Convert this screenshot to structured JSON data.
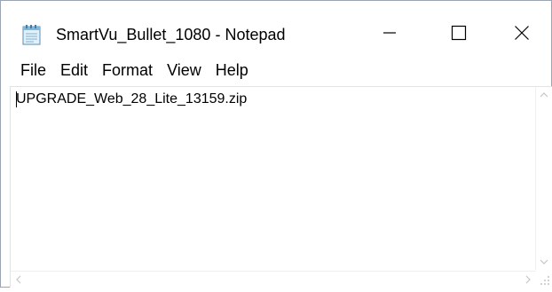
{
  "window": {
    "title": "SmartVu_Bullet_1080 - Notepad",
    "app_icon": "notepad-icon"
  },
  "controls": {
    "minimize_icon": "minimize-icon",
    "maximize_icon": "maximize-icon",
    "close_icon": "close-icon"
  },
  "menu": {
    "items": [
      {
        "label": "File"
      },
      {
        "label": "Edit"
      },
      {
        "label": "Format"
      },
      {
        "label": "View"
      },
      {
        "label": "Help"
      }
    ]
  },
  "editor": {
    "content": "UPGRADE_Web_28_Lite_13159.zip"
  },
  "colors": {
    "border": "#9aa4b2",
    "arrow": "#c5c5c5"
  }
}
